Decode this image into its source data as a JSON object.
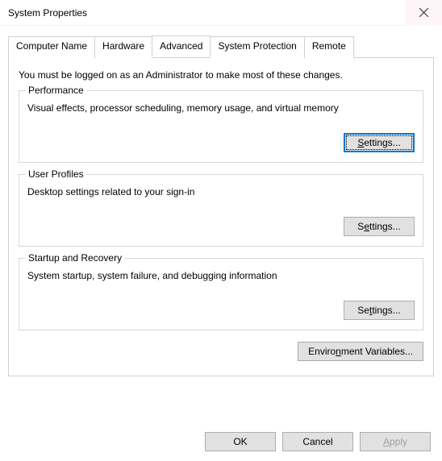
{
  "window": {
    "title": "System Properties"
  },
  "tabs": {
    "computer_name": "Computer Name",
    "hardware": "Hardware",
    "advanced": "Advanced",
    "system_protection": "System Protection",
    "remote": "Remote"
  },
  "intro": "You must be logged on as an Administrator to make most of these changes.",
  "performance": {
    "title": "Performance",
    "desc": "Visual effects, processor scheduling, memory usage, and virtual memory",
    "button": "Settings..."
  },
  "user_profiles": {
    "title": "User Profiles",
    "desc": "Desktop settings related to your sign-in",
    "button": "Settings..."
  },
  "startup_recovery": {
    "title": "Startup and Recovery",
    "desc": "System startup, system failure, and debugging information",
    "button": "Settings..."
  },
  "env_button": "Environment Variables...",
  "buttons": {
    "ok": "OK",
    "cancel": "Cancel",
    "apply": "Apply"
  }
}
